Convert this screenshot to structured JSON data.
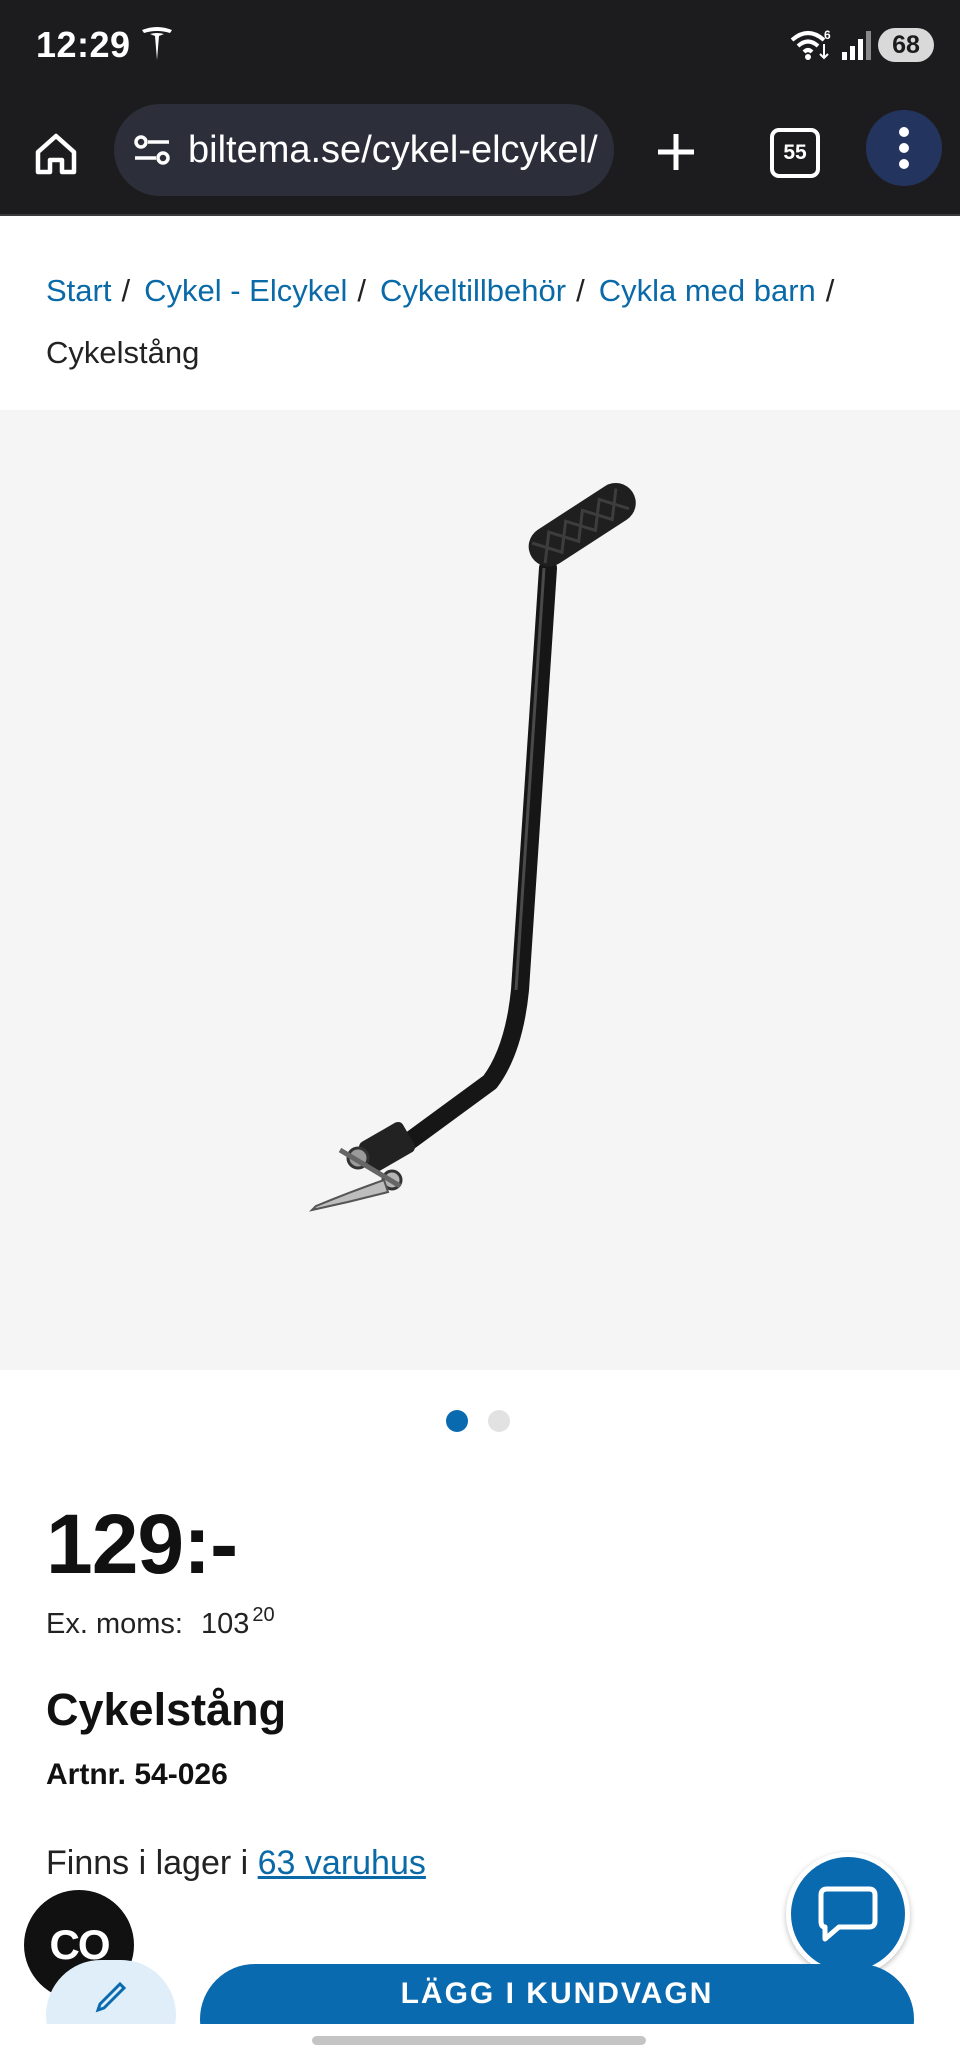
{
  "status_bar": {
    "time": "12:29",
    "wifi_badge": "6",
    "battery": "68"
  },
  "browser": {
    "url": "biltema.se/cykel-elcykel/",
    "tab_count": "55"
  },
  "breadcrumb": {
    "items": [
      "Start",
      "Cykel - Elcykel",
      "Cykeltillbehör",
      "Cykla med barn"
    ],
    "separator": "/",
    "current": "Cykelstång"
  },
  "gallery": {
    "image_count": 2,
    "active_index": 0
  },
  "product": {
    "price": "129:-",
    "ex_vat_label": "Ex. moms:",
    "ex_vat_value": "103",
    "ex_vat_decimals": "20",
    "title": "Cykelstång",
    "article_number": "Artnr. 54-026",
    "stock_prefix": "Finns i lager i ",
    "stock_link": "63 varuhus"
  },
  "buttons": {
    "add_to_cart": "LÄGG I KUNDVAGN",
    "co_badge": "CO"
  },
  "colors": {
    "brand_blue": "#0a6ab0",
    "link_blue": "#0a6aa8",
    "toolbar_dark": "#1c1c1e"
  }
}
